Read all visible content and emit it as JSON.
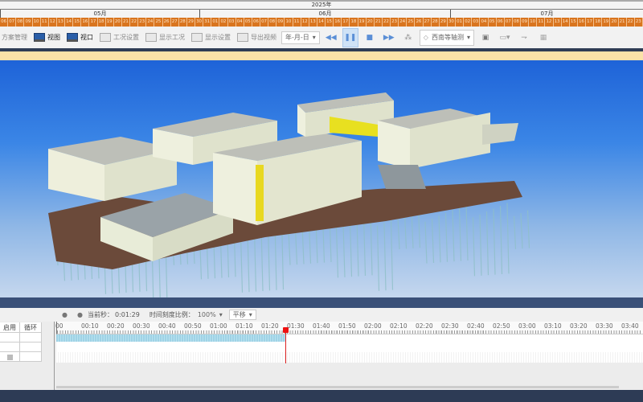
{
  "gantt": {
    "year": "2025年",
    "months": [
      "05月",
      "06月",
      "07月"
    ],
    "days": [
      "06",
      "07",
      "08",
      "09",
      "10",
      "11",
      "12",
      "13",
      "14",
      "15",
      "16",
      "17",
      "18",
      "19",
      "20",
      "21",
      "22",
      "23",
      "24",
      "25",
      "26",
      "27",
      "28",
      "29",
      "30",
      "31",
      "01",
      "02",
      "03",
      "04",
      "05",
      "06",
      "07",
      "08",
      "09",
      "10",
      "11",
      "12",
      "13",
      "14",
      "15",
      "16",
      "17",
      "18",
      "19",
      "20",
      "21",
      "22",
      "23",
      "24",
      "25",
      "26",
      "27",
      "28",
      "29",
      "30",
      "01",
      "02",
      "03",
      "04",
      "05",
      "06",
      "07",
      "08",
      "09",
      "10",
      "11",
      "12",
      "13",
      "14",
      "15",
      "16",
      "17",
      "18",
      "19",
      "20",
      "21",
      "22",
      "23"
    ]
  },
  "toolbar": {
    "plan_manage": "方案管理",
    "view": "视图",
    "viewport": "视口",
    "condition_settings": "工况设置",
    "show_condition": "显示工况",
    "display_settings": "显示设置",
    "export_video": "导出视频",
    "date_format": "年-月-日",
    "view_direction": "西南等轴测",
    "playing": true
  },
  "timeline": {
    "current_label": "当前秒：",
    "current_value": "0:01:29",
    "scale_label": "时间刻度比例：",
    "scale_value": "100%",
    "mode_value": "平移",
    "columns": [
      "启用",
      "循环"
    ],
    "ticks": [
      "00",
      "00:10",
      "00:20",
      "00:30",
      "00:40",
      "00:50",
      "01:00",
      "01:10",
      "01:20",
      "01:30",
      "01:40",
      "01:50",
      "02:00",
      "02:10",
      "02:20",
      "02:30",
      "02:40",
      "02:50",
      "03:00",
      "03:10",
      "03:20",
      "03:30",
      "03:40"
    ],
    "progress_seconds": 89
  }
}
